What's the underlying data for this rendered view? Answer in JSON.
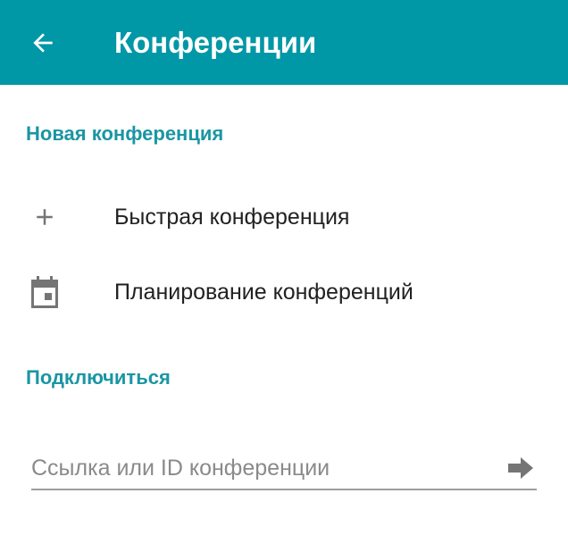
{
  "app_bar": {
    "title": "Конференции",
    "back_icon": "arrow-back-icon",
    "background_color": "#0097a7"
  },
  "sections": {
    "new_conference": {
      "header": "Новая конференция",
      "items": [
        {
          "label": "Быстрая конференция",
          "icon": "plus-icon"
        },
        {
          "label": "Планирование конференций",
          "icon": "calendar-icon"
        }
      ]
    },
    "connect": {
      "header": "Подключиться",
      "field": {
        "value": "",
        "placeholder": "Ссылка или ID конференции",
        "submit_icon": "arrow-forward-icon"
      }
    }
  },
  "colors": {
    "accent": "#1a96a3",
    "icon_gray": "#757575",
    "text_primary": "#212121"
  }
}
